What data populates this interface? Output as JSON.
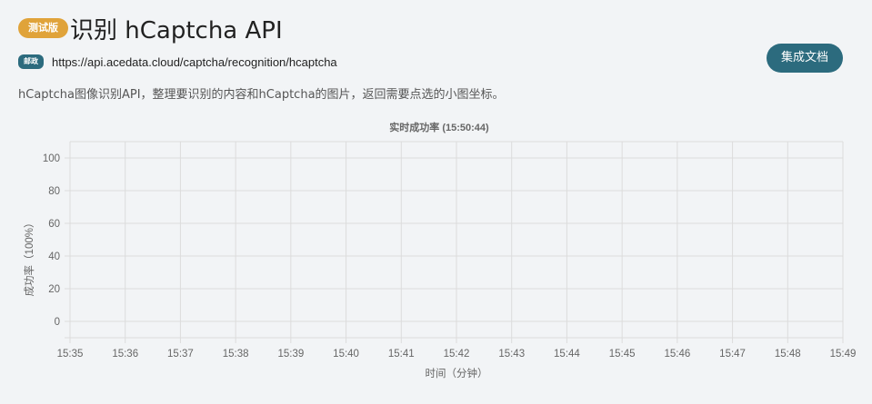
{
  "header": {
    "beta_badge": "测试版",
    "title": "识别 hCaptcha API",
    "method_badge": "邮政",
    "endpoint_url": "https://api.acedata.cloud/captcha/recognition/hcaptcha",
    "docs_button": "集成文档"
  },
  "description": "hCaptcha图像识别API，整理要识别的内容和hCaptcha的图片，返回需要点选的小图坐标。",
  "chart_data": {
    "type": "line",
    "title": "实时成功率 (15:50:44)",
    "xlabel": "时间（分钟）",
    "ylabel": "成功率（100%）",
    "x": [
      "15:35",
      "15:36",
      "15:37",
      "15:38",
      "15:39",
      "15:40",
      "15:41",
      "15:42",
      "15:43",
      "15:44",
      "15:45",
      "15:46",
      "15:47",
      "15:48",
      "15:49"
    ],
    "yticks": [
      0,
      20,
      40,
      60,
      80,
      100
    ],
    "ylim": [
      -10,
      110
    ],
    "series": [],
    "grid": true
  }
}
